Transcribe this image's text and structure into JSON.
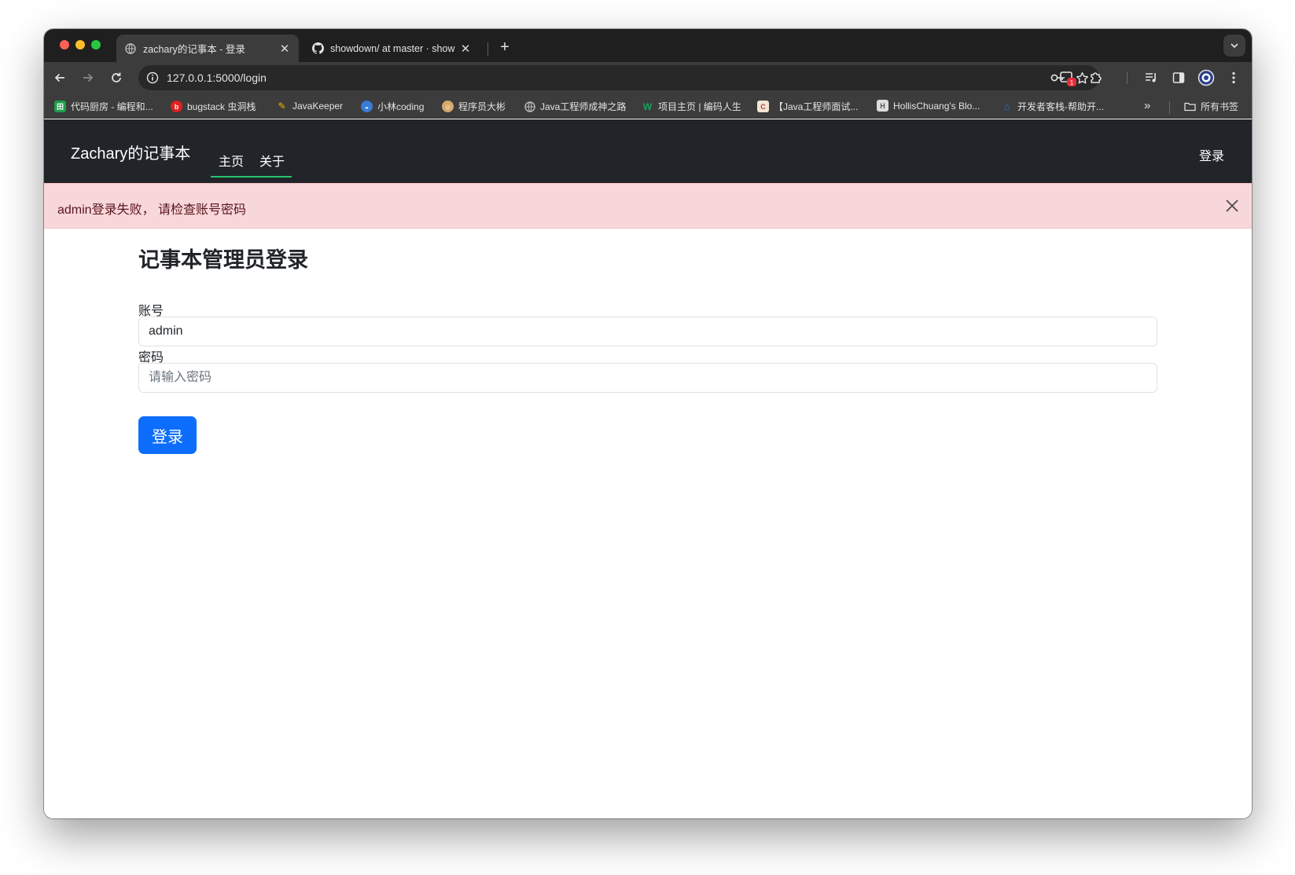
{
  "browser": {
    "tabs": [
      {
        "title": "zachary的记事本 - 登录",
        "favicon": "globe-icon",
        "active": true
      },
      {
        "title": "showdown/ at master · show",
        "favicon": "github-icon",
        "active": false
      }
    ],
    "url": "127.0.0.1:5000/login",
    "extension_badge": "1",
    "bookmarks": [
      {
        "label": "代码厨房 - 编程和...",
        "icon": "grid-icon",
        "color": "#1e9e4a"
      },
      {
        "label": "bugstack 虫洞栈",
        "icon": "bug-icon",
        "color": "#e02020"
      },
      {
        "label": "JavaKeeper",
        "icon": "keeper-icon",
        "color": "#f0b400"
      },
      {
        "label": "小林coding",
        "icon": "coding-icon",
        "color": "#3a7bd5"
      },
      {
        "label": "程序员大彬",
        "icon": "face-icon",
        "color": "#d6a96b"
      },
      {
        "label": "Java工程师成神之路",
        "icon": "globe-icon",
        "color": "#9aa0a6"
      },
      {
        "label": "项目主页 | 编码人生",
        "icon": "w-icon",
        "color": "#1aa260"
      },
      {
        "label": "【Java工程师面试...",
        "icon": "doc-icon",
        "color": "#c0392b"
      },
      {
        "label": "HollisChuang's Blo...",
        "icon": "blog-icon",
        "color": "#dddddd"
      },
      {
        "label": "开发者客栈-帮助开...",
        "icon": "house-icon",
        "color": "#2f6fde"
      }
    ],
    "all_bookmarks_label": "所有书签"
  },
  "navbar": {
    "brand": "Zachary的记事本",
    "links": [
      "主页",
      "关于"
    ],
    "login": "登录"
  },
  "alert": {
    "message": "admin登录失败， 请检查账号密码"
  },
  "form": {
    "heading": "记事本管理员登录",
    "account_label": "账号",
    "account_value": "admin",
    "password_label": "密码",
    "password_placeholder": "请输入密码",
    "submit_label": "登录"
  },
  "colors": {
    "navbar_bg": "#212529",
    "active_underline": "#25c46e",
    "alert_bg": "#f8d7da",
    "alert_text": "#58151c",
    "primary_button": "#0d6efd"
  }
}
